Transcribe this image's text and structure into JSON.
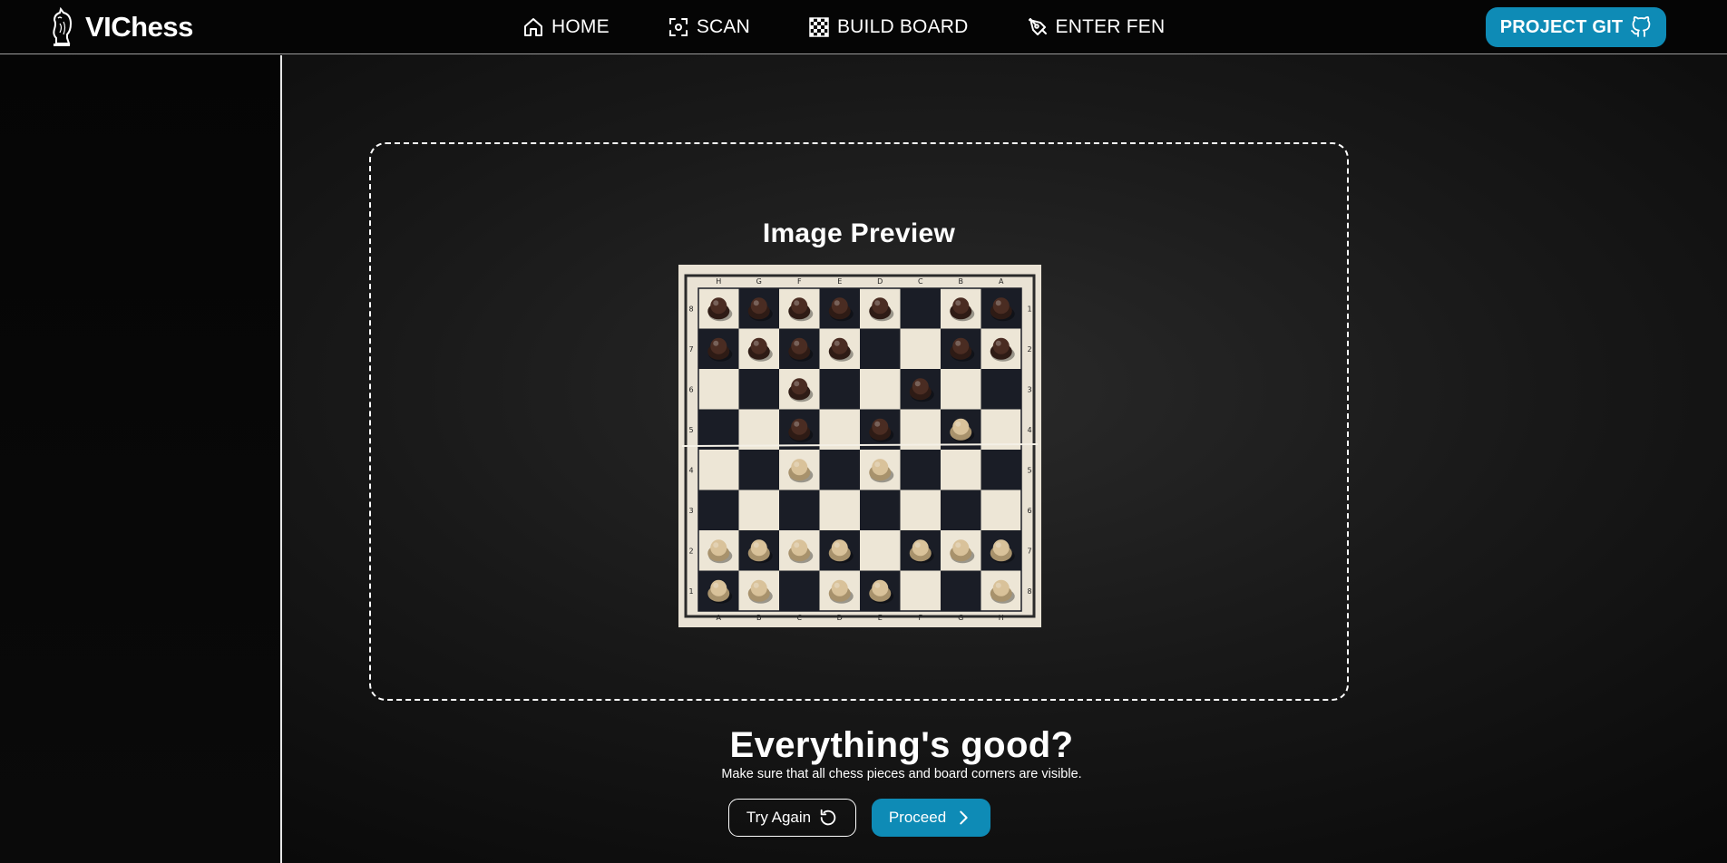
{
  "brand": {
    "name": "VIChess",
    "icon": "knight-icon"
  },
  "nav": {
    "items": [
      {
        "label": "HOME",
        "icon": "home-icon"
      },
      {
        "label": "SCAN",
        "icon": "scan-icon"
      },
      {
        "label": "BUILD BOARD",
        "icon": "checkerboard-icon"
      },
      {
        "label": "ENTER FEN",
        "icon": "pen-nib-icon"
      }
    ]
  },
  "git_button": {
    "label": "PROJECT GIT",
    "icon": "github-icon"
  },
  "preview": {
    "title": "Image Preview",
    "board": {
      "files": [
        "A",
        "B",
        "C",
        "D",
        "E",
        "F",
        "G",
        "H"
      ],
      "ranks": [
        "8",
        "7",
        "6",
        "5",
        "4",
        "3",
        "2",
        "1"
      ],
      "light_square": "#ede6d6",
      "dark_square": "#1a1d26"
    }
  },
  "prompt": {
    "heading": "Everything's good?",
    "hint": "Make sure that all chess pieces and board corners are visible."
  },
  "actions": {
    "try_again": {
      "label": "Try Again",
      "icon": "refresh-icon"
    },
    "proceed": {
      "label": "Proceed",
      "icon": "chevron-right-icon"
    }
  },
  "colors": {
    "accent": "#0e8bb6",
    "background": "#141414",
    "text": "#ffffff"
  }
}
